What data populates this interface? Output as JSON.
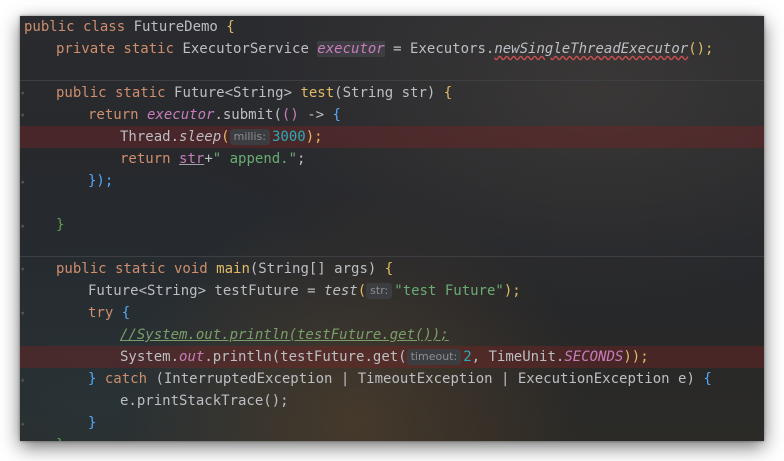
{
  "editor": {
    "lines": {
      "l1": {
        "kw": "public class ",
        "name": "FutureDemo ",
        "brace": "{"
      },
      "l2": {
        "kw": "private static ",
        "type": "ExecutorService ",
        "field": "executor",
        "eq": " = ",
        "cls": "Executors.",
        "method": "newSingleThreadExecutor",
        "tail": "();"
      },
      "l3": {
        "kw": "public static ",
        "type": "Future<String> ",
        "method": "test",
        "params": "(String str) ",
        "brace": "{"
      },
      "l4": {
        "kw": "return ",
        "field": "executor",
        "call": ".submit(",
        "paren": "(",
        "parenclose": ")",
        "arrow": " -> ",
        "brace": "{"
      },
      "l5": {
        "cls": "Thread.",
        "method": "sleep",
        "open": "(",
        "hint": "millis:",
        "num": "3000",
        "close": ");"
      },
      "l6": {
        "kw": "return ",
        "var": "str",
        "plus": "+",
        "str": "\" append.\"",
        "semi": ";"
      },
      "l7": {
        "text": "});"
      },
      "l8": {
        "text": "}"
      },
      "l9": {
        "kw": "public static void ",
        "method": "main",
        "params": "(String[] args) ",
        "brace": "{"
      },
      "l10": {
        "type": "Future<String> testFuture = ",
        "method": "test",
        "open": "(",
        "hint": "str:",
        "str": "\"test Future\"",
        "close": ");"
      },
      "l11": {
        "kw": "try ",
        "brace": "{"
      },
      "l12": {
        "comment": "//System.out.println(testFuture.get());"
      },
      "l13": {
        "cls": "System.",
        "field": "out",
        "call": ".println(testFuture.get(",
        "hint": "timeout:",
        "num": "2",
        "mid": ", TimeUnit.",
        "const": "SECONDS",
        "close": "));"
      },
      "l14": {
        "close": "} ",
        "kw": "catch ",
        "text": "(InterruptedException | TimeoutException | ExecutionException e) ",
        "brace": "{"
      },
      "l15": {
        "text": "e.printStackTrace();"
      },
      "l16": {
        "text": "}"
      },
      "l17": {
        "text": "}"
      }
    }
  }
}
